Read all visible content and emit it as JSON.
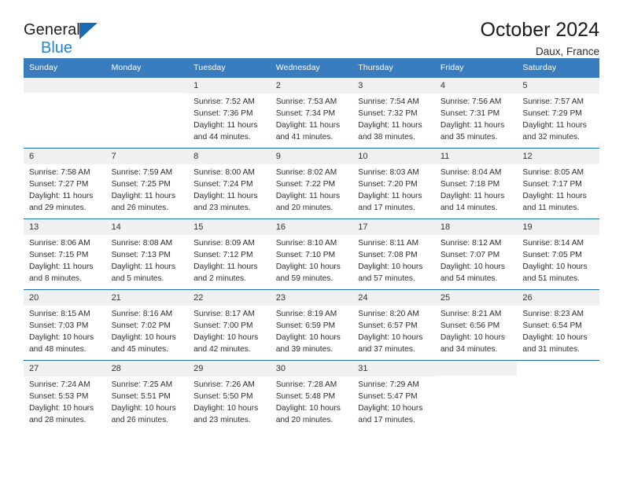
{
  "brand": {
    "name_top": "General",
    "name_bottom": "Blue",
    "triangle_color": "#1b6cb0",
    "blue_text_color": "#1f85d9"
  },
  "header": {
    "title": "October 2024",
    "subtitle": "Daux, France"
  },
  "theme": {
    "header_bar": "#3a7dbf",
    "row_rule": "#1b6cb0",
    "daynum_bg": "#f0f0f0"
  },
  "weekdays": [
    "Sunday",
    "Monday",
    "Tuesday",
    "Wednesday",
    "Thursday",
    "Friday",
    "Saturday"
  ],
  "labels": {
    "sunrise_prefix": "Sunrise:",
    "sunset_prefix": "Sunset:",
    "daylight_prefix": "Daylight:"
  },
  "weeks": [
    [
      {
        "day": "",
        "type": "blank"
      },
      {
        "day": "",
        "type": "blank"
      },
      {
        "day": "1",
        "sunrise": "Sunrise: 7:52 AM",
        "sunset": "Sunset: 7:36 PM",
        "daylight": "Daylight: 11 hours and 44 minutes."
      },
      {
        "day": "2",
        "sunrise": "Sunrise: 7:53 AM",
        "sunset": "Sunset: 7:34 PM",
        "daylight": "Daylight: 11 hours and 41 minutes."
      },
      {
        "day": "3",
        "sunrise": "Sunrise: 7:54 AM",
        "sunset": "Sunset: 7:32 PM",
        "daylight": "Daylight: 11 hours and 38 minutes."
      },
      {
        "day": "4",
        "sunrise": "Sunrise: 7:56 AM",
        "sunset": "Sunset: 7:31 PM",
        "daylight": "Daylight: 11 hours and 35 minutes."
      },
      {
        "day": "5",
        "sunrise": "Sunrise: 7:57 AM",
        "sunset": "Sunset: 7:29 PM",
        "daylight": "Daylight: 11 hours and 32 minutes."
      }
    ],
    [
      {
        "day": "6",
        "sunrise": "Sunrise: 7:58 AM",
        "sunset": "Sunset: 7:27 PM",
        "daylight": "Daylight: 11 hours and 29 minutes."
      },
      {
        "day": "7",
        "sunrise": "Sunrise: 7:59 AM",
        "sunset": "Sunset: 7:25 PM",
        "daylight": "Daylight: 11 hours and 26 minutes."
      },
      {
        "day": "8",
        "sunrise": "Sunrise: 8:00 AM",
        "sunset": "Sunset: 7:24 PM",
        "daylight": "Daylight: 11 hours and 23 minutes."
      },
      {
        "day": "9",
        "sunrise": "Sunrise: 8:02 AM",
        "sunset": "Sunset: 7:22 PM",
        "daylight": "Daylight: 11 hours and 20 minutes."
      },
      {
        "day": "10",
        "sunrise": "Sunrise: 8:03 AM",
        "sunset": "Sunset: 7:20 PM",
        "daylight": "Daylight: 11 hours and 17 minutes."
      },
      {
        "day": "11",
        "sunrise": "Sunrise: 8:04 AM",
        "sunset": "Sunset: 7:18 PM",
        "daylight": "Daylight: 11 hours and 14 minutes."
      },
      {
        "day": "12",
        "sunrise": "Sunrise: 8:05 AM",
        "sunset": "Sunset: 7:17 PM",
        "daylight": "Daylight: 11 hours and 11 minutes."
      }
    ],
    [
      {
        "day": "13",
        "sunrise": "Sunrise: 8:06 AM",
        "sunset": "Sunset: 7:15 PM",
        "daylight": "Daylight: 11 hours and 8 minutes."
      },
      {
        "day": "14",
        "sunrise": "Sunrise: 8:08 AM",
        "sunset": "Sunset: 7:13 PM",
        "daylight": "Daylight: 11 hours and 5 minutes."
      },
      {
        "day": "15",
        "sunrise": "Sunrise: 8:09 AM",
        "sunset": "Sunset: 7:12 PM",
        "daylight": "Daylight: 11 hours and 2 minutes."
      },
      {
        "day": "16",
        "sunrise": "Sunrise: 8:10 AM",
        "sunset": "Sunset: 7:10 PM",
        "daylight": "Daylight: 10 hours and 59 minutes."
      },
      {
        "day": "17",
        "sunrise": "Sunrise: 8:11 AM",
        "sunset": "Sunset: 7:08 PM",
        "daylight": "Daylight: 10 hours and 57 minutes."
      },
      {
        "day": "18",
        "sunrise": "Sunrise: 8:12 AM",
        "sunset": "Sunset: 7:07 PM",
        "daylight": "Daylight: 10 hours and 54 minutes."
      },
      {
        "day": "19",
        "sunrise": "Sunrise: 8:14 AM",
        "sunset": "Sunset: 7:05 PM",
        "daylight": "Daylight: 10 hours and 51 minutes."
      }
    ],
    [
      {
        "day": "20",
        "sunrise": "Sunrise: 8:15 AM",
        "sunset": "Sunset: 7:03 PM",
        "daylight": "Daylight: 10 hours and 48 minutes."
      },
      {
        "day": "21",
        "sunrise": "Sunrise: 8:16 AM",
        "sunset": "Sunset: 7:02 PM",
        "daylight": "Daylight: 10 hours and 45 minutes."
      },
      {
        "day": "22",
        "sunrise": "Sunrise: 8:17 AM",
        "sunset": "Sunset: 7:00 PM",
        "daylight": "Daylight: 10 hours and 42 minutes."
      },
      {
        "day": "23",
        "sunrise": "Sunrise: 8:19 AM",
        "sunset": "Sunset: 6:59 PM",
        "daylight": "Daylight: 10 hours and 39 minutes."
      },
      {
        "day": "24",
        "sunrise": "Sunrise: 8:20 AM",
        "sunset": "Sunset: 6:57 PM",
        "daylight": "Daylight: 10 hours and 37 minutes."
      },
      {
        "day": "25",
        "sunrise": "Sunrise: 8:21 AM",
        "sunset": "Sunset: 6:56 PM",
        "daylight": "Daylight: 10 hours and 34 minutes."
      },
      {
        "day": "26",
        "sunrise": "Sunrise: 8:23 AM",
        "sunset": "Sunset: 6:54 PM",
        "daylight": "Daylight: 10 hours and 31 minutes."
      }
    ],
    [
      {
        "day": "27",
        "sunrise": "Sunrise: 7:24 AM",
        "sunset": "Sunset: 5:53 PM",
        "daylight": "Daylight: 10 hours and 28 minutes."
      },
      {
        "day": "28",
        "sunrise": "Sunrise: 7:25 AM",
        "sunset": "Sunset: 5:51 PM",
        "daylight": "Daylight: 10 hours and 26 minutes."
      },
      {
        "day": "29",
        "sunrise": "Sunrise: 7:26 AM",
        "sunset": "Sunset: 5:50 PM",
        "daylight": "Daylight: 10 hours and 23 minutes."
      },
      {
        "day": "30",
        "sunrise": "Sunrise: 7:28 AM",
        "sunset": "Sunset: 5:48 PM",
        "daylight": "Daylight: 10 hours and 20 minutes."
      },
      {
        "day": "31",
        "sunrise": "Sunrise: 7:29 AM",
        "sunset": "Sunset: 5:47 PM",
        "daylight": "Daylight: 10 hours and 17 minutes."
      },
      {
        "day": "",
        "type": "blank"
      },
      {
        "day": "",
        "type": "empty"
      }
    ]
  ]
}
